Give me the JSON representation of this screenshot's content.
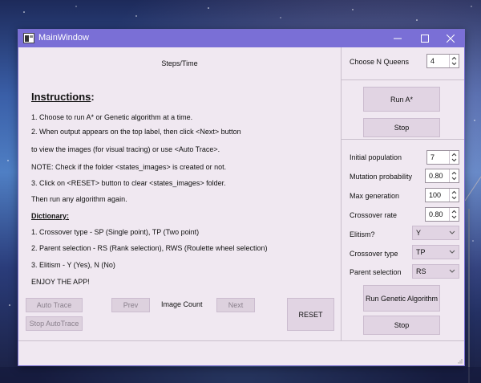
{
  "window": {
    "title": "MainWindow"
  },
  "top_label": "Steps/Time",
  "instructions": {
    "heading": "Instructions",
    "colon": ":",
    "lines": [
      "1. Choose to run A* or Genetic algorithm at a time.",
      "2. When output appears on the top label, then click <Next> button",
      "to view the images (for visual tracing) or use <Auto Trace>.",
      "NOTE: Check if the folder <states_images> is created or not.",
      "3. Click on <RESET> button to clear <states_images> folder.",
      "Then run any algorithm again."
    ]
  },
  "dictionary": {
    "heading": "Dictionary:",
    "lines": [
      "1. Crossover type - SP (Single point), TP (Two point)",
      "2. Parent selection - RS (Rank selection), RWS (Roulette wheel selection)",
      "3. Elitism - Y (Yes), N (No)"
    ],
    "footer": "ENJOY THE APP!"
  },
  "controls": {
    "auto_trace": "Auto Trace",
    "stop_autotrace": "Stop AutoTrace",
    "prev": "Prev",
    "image_count": "Image Count",
    "next": "Next",
    "reset": "RESET"
  },
  "astar": {
    "queens_label": "Choose N Queens",
    "queens_value": "4",
    "run_label": "Run A*",
    "stop_label": "Stop"
  },
  "genetic": {
    "fields": [
      {
        "label": "Initial population",
        "value": "7"
      },
      {
        "label": "Mutation probability",
        "value": "0.80"
      },
      {
        "label": "Max generation",
        "value": "100"
      },
      {
        "label": "Crossover rate",
        "value": "0.80"
      }
    ],
    "combos": [
      {
        "label": "Elitism?",
        "value": "Y"
      },
      {
        "label": "Crossover type",
        "value": "TP"
      },
      {
        "label": "Parent selection",
        "value": "RS"
      }
    ],
    "run_label": "Run Genetic Algorithm",
    "stop_label": "Stop"
  }
}
